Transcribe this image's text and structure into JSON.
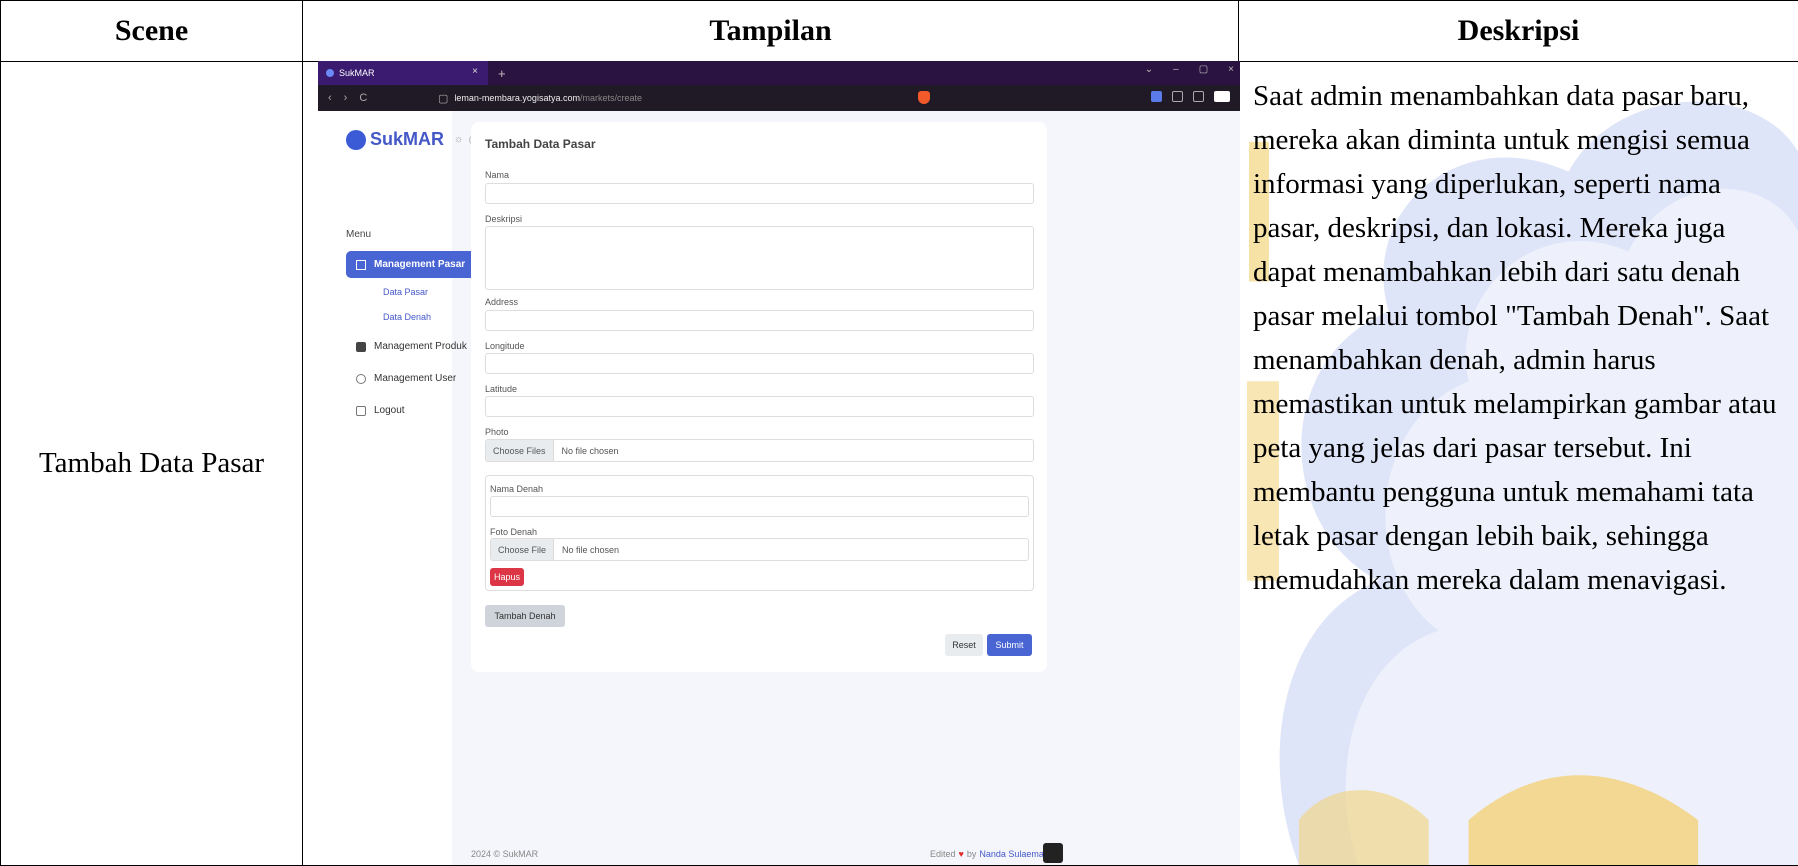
{
  "table": {
    "header_scene": "Scene",
    "header_tampilan": "Tampilan",
    "header_deskripsi": "Deskripsi",
    "scene_text": "Tambah Data Pasar",
    "description": "Saat admin menambahkan data pasar baru, mereka akan diminta untuk mengisi semua informasi yang diperlukan, seperti nama pasar, deskripsi, dan lokasi. Mereka juga dapat menambahkan lebih dari satu denah pasar melalui tombol \"Tambah Denah\". Saat menambahkan denah, admin harus memastikan untuk melampirkan gambar atau peta yang jelas dari pasar tersebut. Ini membantu pengguna untuk memahami tata letak pasar dengan lebih baik, sehingga memudahkan mereka dalam menavigasi."
  },
  "browser": {
    "tab_title": "SukMAR",
    "tab_close": "×",
    "new_tab": "+",
    "url_host": "leman-membara.yogisatya.com",
    "url_path": "/markets/create",
    "window_controls": [
      "⌄",
      "–",
      "▢",
      "×"
    ],
    "nav_icons": [
      "‹",
      "›",
      "C",
      "▢"
    ]
  },
  "app": {
    "logo": "SukMAR",
    "theme_sun": "☼",
    "theme_moon": "☾",
    "menu_title": "Menu",
    "nav": {
      "management_pasar": "Management Pasar",
      "data_pasar": "Data Pasar",
      "data_denah": "Data Denah",
      "management_produk": "Management Produk",
      "management_user": "Management User",
      "logout": "Logout"
    },
    "chevron": "⌄",
    "form": {
      "title": "Tambah Data Pasar",
      "nama_label": "Nama",
      "deskripsi_label": "Deskripsi",
      "address_label": "Address",
      "longitude_label": "Longitude",
      "latitude_label": "Latitude",
      "photo_label": "Photo",
      "photo_button": "Choose Files",
      "photo_status": "No file chosen",
      "nama_denah_label": "Nama Denah",
      "foto_denah_label": "Foto Denah",
      "foto_denah_button": "Choose File",
      "foto_denah_status": "No file chosen",
      "hapus_button": "Hapus",
      "tambah_denah_button": "Tambah Denah",
      "reset_button": "Reset",
      "submit_button": "Submit"
    },
    "footer": {
      "copyright": "2024 © SukMAR",
      "edited": "Edited",
      "heart": "♥",
      "by": "by",
      "author": "Nanda Sulaeman"
    }
  },
  "colors": {
    "accent": "#4964d3",
    "danger": "#dc3545",
    "browser_dark": "#2b1341",
    "watermark_blue": "#c3cdf0",
    "watermark_gold": "#f4d27a"
  }
}
